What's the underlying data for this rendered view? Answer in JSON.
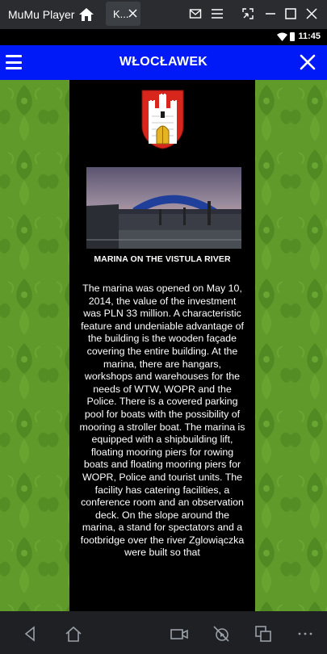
{
  "emulator": {
    "title": "MuMu Player",
    "tab_label": "K...",
    "icons": [
      "home-icon",
      "mail-icon",
      "menu-icon",
      "screenshot-icon",
      "minimize-icon",
      "maximize-icon",
      "close-icon"
    ]
  },
  "status_bar": {
    "time": "11:45",
    "icons": [
      "wifi-icon",
      "battery-icon"
    ]
  },
  "header": {
    "title": "WŁOCŁAWEK",
    "background": "#0019f7",
    "menu_icon": "hamburger-menu-icon",
    "close_icon": "close-x-icon"
  },
  "content": {
    "crest_alt": "coat-of-arms",
    "photo_alt": "marina-photo",
    "caption": "MARINA ON THE VISTULA RIVER",
    "body": "The marina was opened on May 10, 2014, the value of the investment was PLN 33 million. A characteristic feature and undeniable advantage of the building is the wooden façade covering the entire building. At the marina, there are hangars, workshops and warehouses for the needs of WTW, WOPR and the Police. There is a covered parking pool for boats with the possibility of mooring a stroller boat. The marina is equipped with a shipbuilding lift, floating mooring piers for rowing boats and floating mooring piers for WOPR, Police and tourist units. The facility has catering facilities, a conference room and an observation deck. On the slope around the marina, a stand for spectators and a footbridge over the river Zglowiączka were built so that"
  },
  "nav_bar": {
    "icons": [
      "back-icon",
      "home-icon",
      "camera-icon",
      "no-video-icon",
      "multi-window-icon",
      "more-icon"
    ]
  },
  "colors": {
    "background_green": "#5f9a2a",
    "panel": "#000000",
    "crest_red": "#d9261c",
    "crest_gold": "#e6b422"
  }
}
